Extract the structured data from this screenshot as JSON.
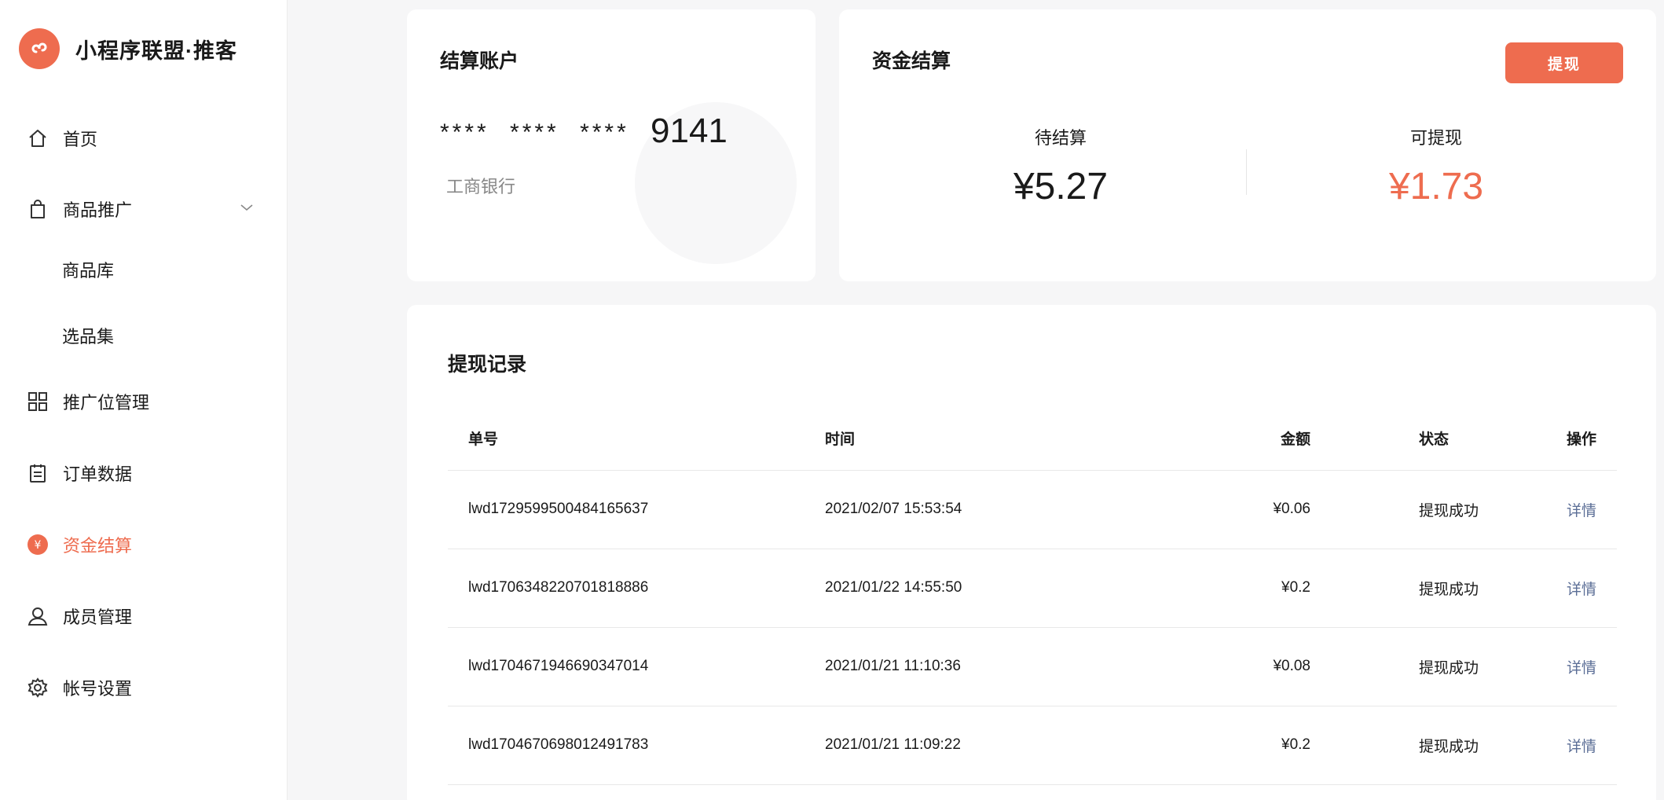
{
  "brand": {
    "name": "小程序联盟·推客",
    "logo_icon": "mini-program-logo-icon",
    "accent": "#ee6c4f"
  },
  "sidebar": {
    "items": [
      {
        "label": "首页",
        "icon": "home-icon"
      },
      {
        "label": "商品推广",
        "icon": "shopping-bag-icon",
        "expanded": true
      },
      {
        "label": "推广位管理",
        "icon": "grid-icon"
      },
      {
        "label": "订单数据",
        "icon": "clipboard-icon"
      },
      {
        "label": "资金结算",
        "icon": "yen-icon",
        "active": true
      },
      {
        "label": "成员管理",
        "icon": "user-icon"
      },
      {
        "label": "帐号设置",
        "icon": "gear-icon"
      }
    ],
    "sub_items": [
      {
        "label": "商品库"
      },
      {
        "label": "选品集"
      }
    ]
  },
  "account": {
    "title": "结算账户",
    "masked": "**** **** ****",
    "last4": "9141",
    "bank": "工商银行"
  },
  "funds": {
    "title": "资金结算",
    "withdraw_label": "提现",
    "pending_label": "待结算",
    "pending_value": "¥5.27",
    "available_label": "可提现",
    "available_value": "¥1.73",
    "available_color": "#ee6c4f"
  },
  "records": {
    "title": "提现记录",
    "columns": [
      "单号",
      "时间",
      "金额",
      "状态",
      "操作"
    ],
    "rows": [
      {
        "id": "lwd1729599500484165637",
        "time": "2021/02/07 15:53:54",
        "amount": "¥0.06",
        "status": "提现成功",
        "action": "详情"
      },
      {
        "id": "lwd1706348220701818886",
        "time": "2021/01/22 14:55:50",
        "amount": "¥0.2",
        "status": "提现成功",
        "action": "详情"
      },
      {
        "id": "lwd1704671946690347014",
        "time": "2021/01/21 11:10:36",
        "amount": "¥0.08",
        "status": "提现成功",
        "action": "详情"
      },
      {
        "id": "lwd1704670698012491783",
        "time": "2021/01/21 11:09:22",
        "amount": "¥0.2",
        "status": "提现成功",
        "action": "详情"
      }
    ]
  }
}
